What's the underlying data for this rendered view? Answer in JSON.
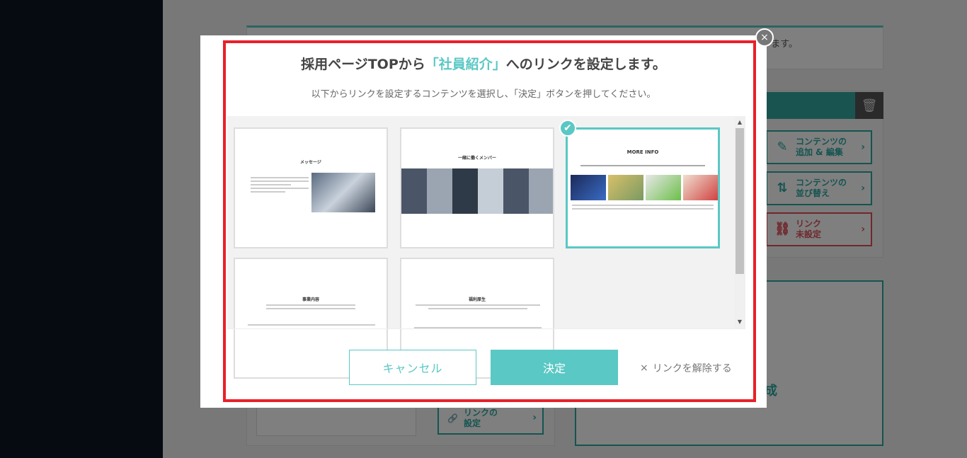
{
  "background": {
    "top_note_text": "ます。",
    "side_buttons": [
      {
        "label_1": "コンテンツの",
        "label_2": "追加 & 編集",
        "icon": "pencil-icon"
      },
      {
        "label_1": "コンテンツの",
        "label_2": "並び替え",
        "icon": "sort-arrows-icon"
      },
      {
        "label_1": "リンク",
        "label_2": "未設定",
        "icon": "unlink-icon"
      }
    ],
    "link_button": {
      "label_1": "リンクの",
      "label_2": "設定",
      "icon": "link-icon"
    },
    "big_box_text": "成"
  },
  "modal": {
    "title_prefix": "採用ページTOPから",
    "title_accent": "「社員紹介」",
    "title_suffix": "へのリンクを設定します。",
    "subtitle": "以下からリンクを設定するコンテンツを選択し、「決定」ボタンを押してください。",
    "close_symbol": "×",
    "tiles": [
      {
        "heading": "メッセージ",
        "selected": false
      },
      {
        "heading": "一緒に働くメンバー",
        "selected": false
      },
      {
        "heading": "MORE INFO",
        "selected": true
      },
      {
        "heading": "事業内容",
        "selected": false
      },
      {
        "heading": "福利厚生",
        "selected": false
      }
    ],
    "check_symbol": "✔",
    "cancel_label": "キャンセル",
    "ok_label": "決定",
    "unlink_symbol": "×",
    "unlink_label": "リンクを解除する"
  },
  "colors": {
    "accent": "#5ac8c4",
    "highlight": "#e8202a",
    "warn": "#e0505a"
  }
}
